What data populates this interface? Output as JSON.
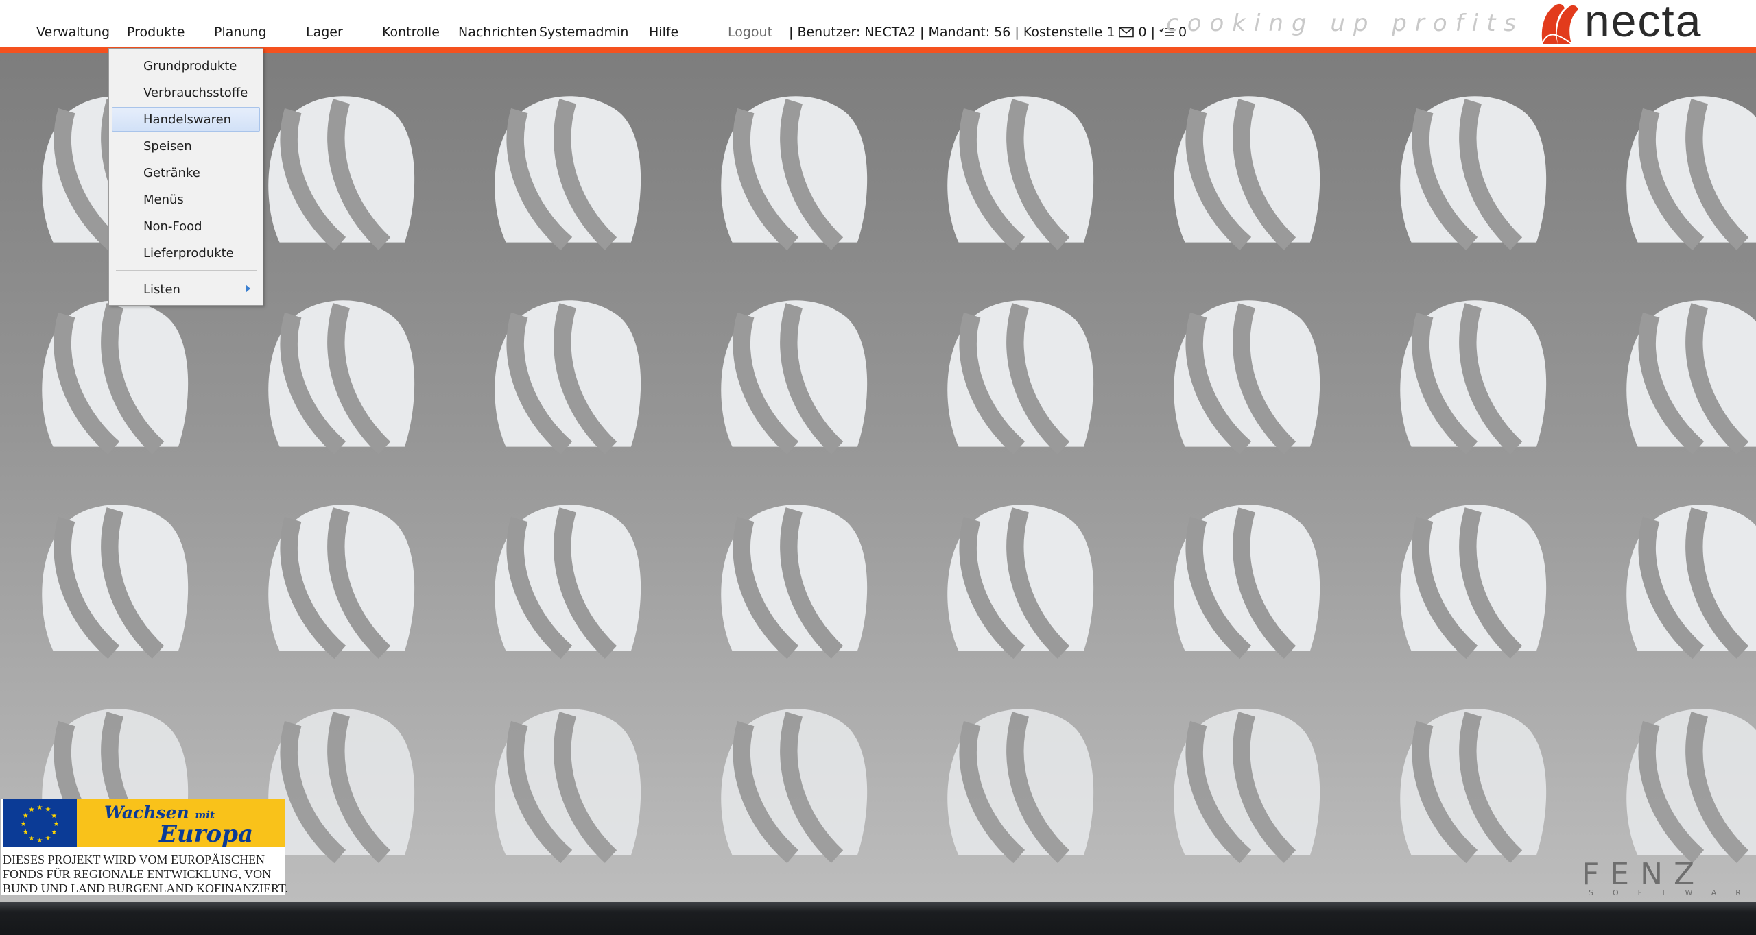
{
  "menu": {
    "items": [
      "Verwaltung",
      "Produkte",
      "Planung",
      "Lager",
      "Kontrolle",
      "Nachrichten",
      "Systemadmin",
      "Hilfe"
    ],
    "logout": "Logout"
  },
  "status": {
    "user_text": "| Benutzer: NECTA2 | Mandant: 56 | Kostenstelle 1",
    "mail_icon": "envelope-icon",
    "mail_count": "0",
    "separator": "|",
    "tasks_icon": "task-list-icon",
    "tasks_count": "0"
  },
  "branding": {
    "slogan": "cooking up profits",
    "logo_text": "necta",
    "logo_colors": {
      "mark": "#e23b1c",
      "text": "#2b2b2b"
    },
    "accent": "#f4511e"
  },
  "dropdown": {
    "parent": "Produkte",
    "items": [
      "Grundprodukte",
      "Verbrauchsstoffe",
      "Handelswaren",
      "Speisen",
      "Getränke",
      "Menüs",
      "Non-Food",
      "Lieferprodukte"
    ],
    "highlighted": "Handelswaren",
    "submenu": "Listen"
  },
  "eu_badge": {
    "line1_a": "Wachsen",
    "line1_b": "mit",
    "line2": "Europa",
    "text": [
      "DIESES PROJEKT WIRD VOM EUROPÄISCHEN",
      "FONDS FÜR REGIONALE ENTWICKLUNG, VON",
      "BUND UND LAND BURGENLAND KOFINANZIERT."
    ]
  },
  "watermark": {
    "name": "FENZ",
    "sub": "SOFTWARE"
  }
}
